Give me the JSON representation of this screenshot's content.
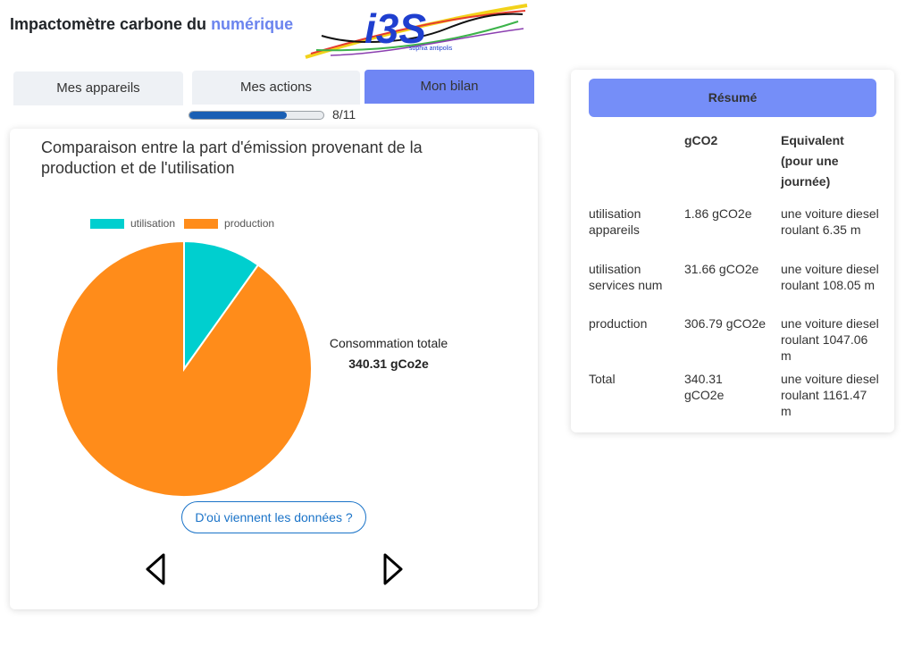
{
  "header": {
    "title_main": "Impactomètre carbone du ",
    "title_accent": "numérique",
    "logo_text": "i3S",
    "logo_subtext": "sophia antipolis"
  },
  "tabs": [
    {
      "label": "Mes appareils",
      "active": false
    },
    {
      "label": "Mes actions",
      "active": false
    },
    {
      "label": "Mon bilan",
      "active": true
    }
  ],
  "progress": {
    "label": "8/11",
    "fraction": 0.727
  },
  "chart_card": {
    "title": "Comparaison entre la part d'émission provenant de la production et de l'utilisation",
    "total_label": "Consommation totale",
    "total_value": "340.31 gCo2e",
    "source_button": "D'où viennent les données ?"
  },
  "chart_data": {
    "type": "pie",
    "categories": [
      "utilisation",
      "production"
    ],
    "values": [
      33.52,
      306.79
    ],
    "colors": [
      "#00cfcf",
      "#ff8c1a"
    ],
    "legend": "top"
  },
  "summary": {
    "header": "Résumé",
    "columns": [
      "",
      "gCO2",
      "Equivalent (pour une journée)"
    ],
    "rows": [
      [
        "utilisation appareils",
        "1.86 gCO2e",
        "une voiture diesel roulant 6.35 m"
      ],
      [
        "utilisation services num",
        "31.66 gCO2e",
        "une voiture diesel roulant 108.05 m"
      ],
      [
        "production",
        "306.79 gCO2e",
        "une voiture diesel roulant 1047.06 m"
      ],
      [
        "Total",
        "340.31 gCO2e",
        "une voiture diesel roulant 1161.47 m"
      ]
    ]
  },
  "icons": {
    "prev": "triangle-left-icon",
    "next": "triangle-right-icon"
  }
}
